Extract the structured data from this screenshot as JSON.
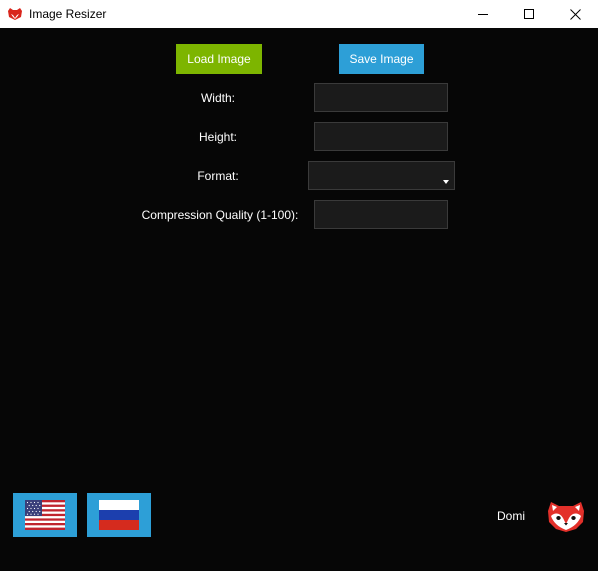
{
  "window": {
    "title": "Image Resizer",
    "icon": "red-panda-icon",
    "controls": [
      "minimize-icon",
      "maximize-icon",
      "close-icon"
    ]
  },
  "toolbar": {
    "load_label": "Load Image",
    "save_label": "Save Image",
    "load_color": "#7db500",
    "save_color": "#2d9fd7"
  },
  "form": {
    "width_label": "Width:",
    "width_value": "",
    "height_label": "Height:",
    "height_value": "",
    "format_label": "Format:",
    "format_value": "",
    "quality_label": "Compression Quality (1-100):",
    "quality_value": ""
  },
  "language": {
    "options": [
      "us-flag-icon",
      "ru-flag-icon"
    ],
    "button_color": "#2d9fd7"
  },
  "footer": {
    "author": "Domi",
    "logo": "red-panda-icon"
  }
}
